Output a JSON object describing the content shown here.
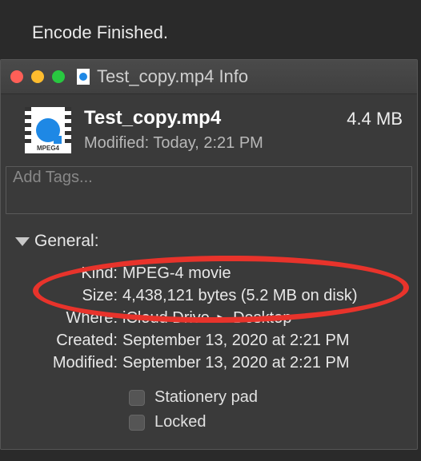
{
  "status_message": "Encode Finished.",
  "window": {
    "title": "Test_copy.mp4 Info"
  },
  "file": {
    "name": "Test_copy.mp4",
    "icon_label": "MPEG4",
    "size_summary": "4.4 MB",
    "modified_summary_prefix": "Modified:",
    "modified_summary_value": "Today, 2:21 PM"
  },
  "tags": {
    "placeholder": "Add Tags..."
  },
  "general": {
    "heading": "General:",
    "rows": {
      "kind": {
        "label": "Kind:",
        "value": "MPEG-4 movie"
      },
      "size": {
        "label": "Size:",
        "value": "4,438,121 bytes (5.2 MB on disk)"
      },
      "where": {
        "label": "Where:",
        "value_parts": [
          "iCloud Drive",
          "Desktop"
        ],
        "sep": "▸"
      },
      "created": {
        "label": "Created:",
        "value": "September 13, 2020 at 2:21 PM"
      },
      "modified": {
        "label": "Modified:",
        "value": "September 13, 2020 at 2:21 PM"
      }
    }
  },
  "checks": {
    "stationery": {
      "label": "Stationery pad",
      "checked": false
    },
    "locked": {
      "label": "Locked",
      "checked": false
    }
  },
  "annotation": {
    "color": "#e8332b"
  }
}
